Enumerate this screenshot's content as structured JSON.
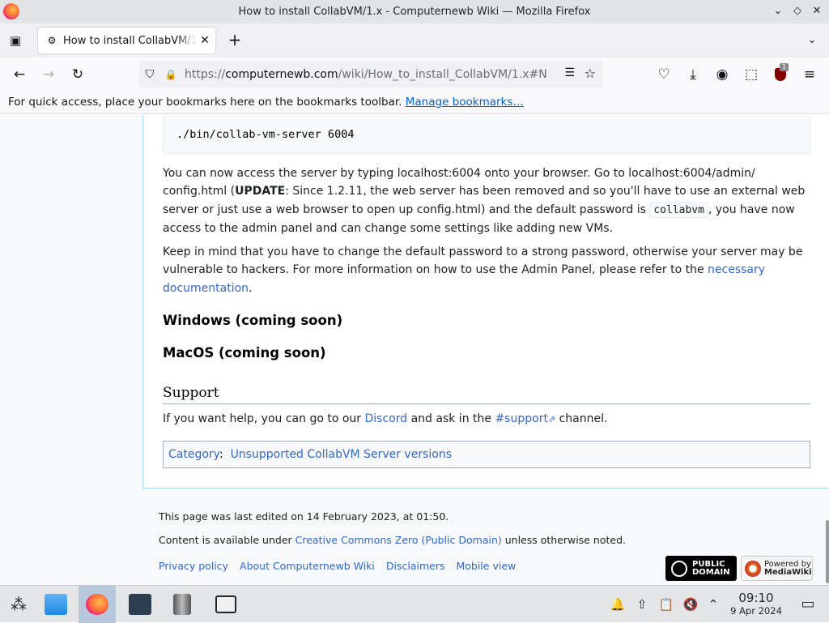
{
  "window": {
    "title": "How to install CollabVM/1.x - Computernewb Wiki — Mozilla Firefox",
    "min_icon": "⌄",
    "max_icon": "◇",
    "close_icon": "✕"
  },
  "tabs": {
    "alltabs_icon": "▣",
    "active_title": "How to install CollabVM/1.x",
    "favicon": "⚙",
    "close": "✕",
    "new_tab": "+",
    "list": "⌄"
  },
  "nav": {
    "back": "←",
    "forward": "→",
    "reload": "↻",
    "url_prefix": "https://",
    "url_host": "computernewb.com",
    "url_path": "/wiki/How_to_install_CollabVM/1.x#N",
    "shield": "⛉",
    "lock": "🔒",
    "reader": "☰",
    "star": "☆",
    "pocket": "♡",
    "download": "⤓",
    "account": "◉",
    "extensions": "⬚",
    "addon_badge": "1",
    "menu": "≡"
  },
  "bookmarks": {
    "text": "For quick access, place your bookmarks here on the bookmarks toolbar.",
    "link": "Manage bookmarks…"
  },
  "article": {
    "command": "./bin/collab-vm-server 6004",
    "p1_a": "You can now access the server by typing localhost:6004 onto your browser. Go to localhost:6004/admin/ config.html (",
    "p1_bold": "UPDATE",
    "p1_b": ": Since 1.2.11, the web server has been removed and so you'll have to use an external web server or just use a web browser to open up config.html) and the default password is ",
    "p1_code": "collabvm",
    "p1_c": ", you have now access to the admin panel and can change some settings like adding new VMs.",
    "p2_a": "Keep in mind that you have to change the default password to a strong password, otherwise your server may be vulnerable to hackers. For more information on how to use the Admin Panel, please refer to the ",
    "p2_link": "necessary documentation",
    "p2_end": ".",
    "h_windows": "Windows (coming soon)",
    "h_macos": "MacOS (coming soon)",
    "h_support": "Support",
    "p3_a": "If you want help, you can go to our ",
    "p3_discord": "Discord",
    "p3_b": " and ask in the ",
    "p3_channel": "#support",
    "p3_ext": "⇗",
    "p3_c": " channel.",
    "category_label": "Category",
    "category_sep": ":",
    "category_value": "Unsupported CollabVM Server versions"
  },
  "footer": {
    "last_edited": "This page was last edited on 14 February 2023, at 01:50.",
    "license_a": "Content is available under ",
    "license_link": "Creative Commons Zero (Public Domain)",
    "license_b": " unless otherwise noted.",
    "links": [
      "Privacy policy",
      "About Computernewb Wiki",
      "Disclaimers",
      "Mobile view"
    ],
    "badge_pd_line1": "PUBLIC",
    "badge_pd_line2": "DOMAIN",
    "badge_mw_line1": "Powered by",
    "badge_mw_line2": "MediaWiki"
  },
  "taskbar": {
    "launcher": "⁂",
    "files": "▭",
    "tray_notify": "🔔",
    "tray_update": "⇧",
    "tray_clipboard": "📋",
    "tray_volume": "🔇",
    "tray_expand": "⌃",
    "time": "09:10",
    "date": "9 Apr 2024",
    "desktop": "▭"
  }
}
